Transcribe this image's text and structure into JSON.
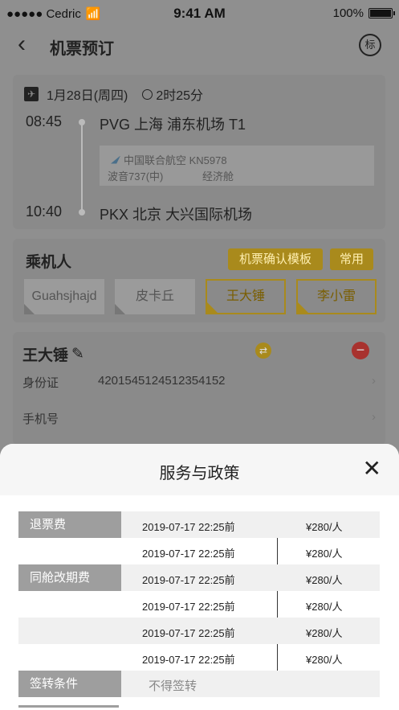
{
  "status_bar": {
    "carrier": "●●●●● Cedric",
    "time": "9:41 AM",
    "battery": "100%"
  },
  "nav": {
    "title": "机票预订",
    "right_badge": "标"
  },
  "flight": {
    "date": "1月28日(周四)",
    "duration": "2时25分",
    "depart_time": "08:45",
    "depart_airport": "PVG 上海 浦东机场 T1",
    "airline": "中国联合航空 KN5978",
    "aircraft": "波音737(中)",
    "cabin": "经济舱",
    "arrive_time": "10:40",
    "arrive_airport": "PKX 北京 大兴国际机场"
  },
  "passengers": {
    "heading": "乘机人",
    "template_button": "机票确认模板",
    "common_button": "常用",
    "chips": [
      {
        "name": "Guahsjhajd",
        "selected": false
      },
      {
        "name": "皮卡丘",
        "selected": false
      },
      {
        "name": "王大锤",
        "selected": true
      },
      {
        "name": "李小雷",
        "selected": true
      }
    ]
  },
  "person": {
    "name": "王大锤",
    "id_label": "身份证",
    "id_value": "4201545124512354152",
    "phone_label": "手机号"
  },
  "policy": {
    "title": "服务与政策",
    "rows": [
      {
        "category": "退票费",
        "date": "2019-07-17 22:25前",
        "price": "¥280/人"
      },
      {
        "category": "",
        "date": "2019-07-17 22:25前",
        "price": "¥280/人"
      },
      {
        "category": "同舱改期费",
        "date": "2019-07-17 22:25前",
        "price": "¥280/人"
      },
      {
        "category": "",
        "date": "2019-07-17 22:25前",
        "price": "¥280/人"
      },
      {
        "category": "",
        "date": "2019-07-17 22:25前",
        "price": "¥280/人"
      },
      {
        "category": "",
        "date": "2019-07-17 22:25前",
        "price": "¥280/人"
      }
    ],
    "endorse_label": "签转条件",
    "endorse_value": "不得签转"
  }
}
